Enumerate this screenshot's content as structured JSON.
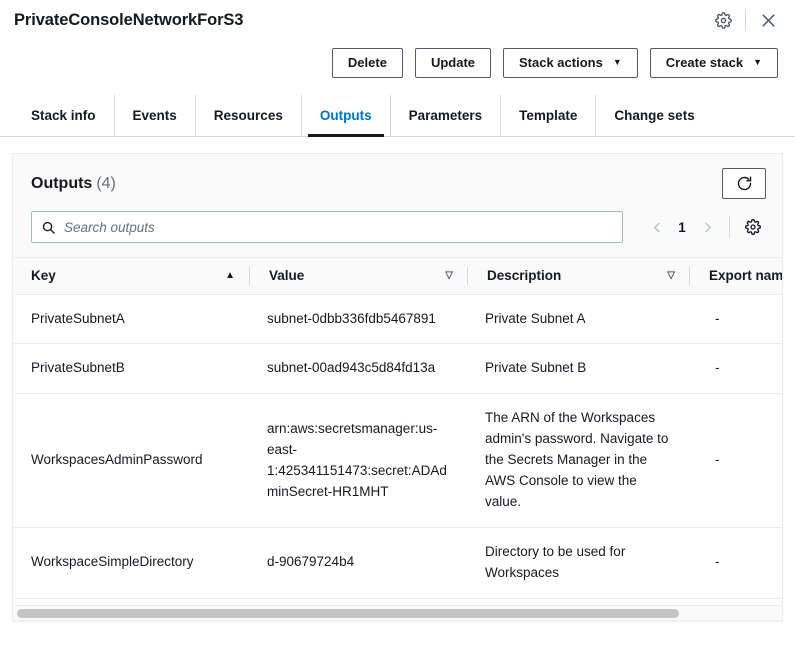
{
  "header": {
    "stack_name": "PrivateConsoleNetworkForS3",
    "settings_icon": "gear-icon",
    "close_icon": "close-icon"
  },
  "actions": {
    "delete_label": "Delete",
    "update_label": "Update",
    "stack_actions_label": "Stack actions",
    "create_stack_label": "Create stack",
    "caret_glyph": "▼"
  },
  "tabs": [
    {
      "label": "Stack info",
      "active": false
    },
    {
      "label": "Events",
      "active": false
    },
    {
      "label": "Resources",
      "active": false
    },
    {
      "label": "Outputs",
      "active": true
    },
    {
      "label": "Parameters",
      "active": false
    },
    {
      "label": "Template",
      "active": false
    },
    {
      "label": "Change sets",
      "active": false
    }
  ],
  "panel": {
    "title": "Outputs",
    "count": "(4)",
    "refresh_icon": "refresh-icon",
    "preferences_icon": "gear-icon"
  },
  "search": {
    "placeholder": "Search outputs",
    "value": "",
    "icon": "search-icon"
  },
  "pagination": {
    "prev_icon": "chevron-left-icon",
    "next_icon": "chevron-right-icon",
    "current_page": "1"
  },
  "table": {
    "columns": [
      {
        "label": "Key",
        "sort": "asc",
        "sort_glyph": "▲"
      },
      {
        "label": "Value",
        "sort": "none",
        "sort_glyph": "▽"
      },
      {
        "label": "Description",
        "sort": "none",
        "sort_glyph": "▽"
      },
      {
        "label": "Export name",
        "sort": null,
        "sort_glyph": ""
      }
    ],
    "rows": [
      {
        "key": "PrivateSubnetA",
        "value": "subnet-0dbb336fdb5467891",
        "description": "Private Subnet A",
        "export_name": "-"
      },
      {
        "key": "PrivateSubnetB",
        "value": "subnet-00ad943c5d84fd13a",
        "description": "Private Subnet B",
        "export_name": "-"
      },
      {
        "key": "WorkspacesAdminPassword",
        "value": "arn:aws:secretsmanager:us-east-1:425341151473:secret:ADAdminSecret-HR1MHT",
        "description": "The ARN of the Workspaces admin's password. Navigate to the Secrets Manager in the AWS Console to view the value.",
        "export_name": "-"
      },
      {
        "key": "WorkspaceSimpleDirectory",
        "value": "d-90679724b4",
        "description": "Directory to be used for Workspaces",
        "export_name": "-"
      }
    ]
  },
  "colors": {
    "accent_link": "#0073bb",
    "text_primary": "#16191f",
    "text_secondary": "#687078",
    "border": "#eaeded",
    "panel_head_bg": "#fafafa"
  }
}
